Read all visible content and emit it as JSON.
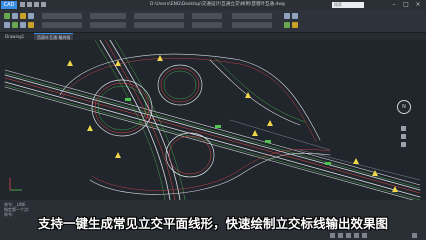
{
  "app": {
    "logo": "CAD",
    "title": "D:\\Users\\ENG\\Desktop\\交通设计\\互通立交\\样例\\苜蓿叶互通.dwg",
    "search_placeholder": "搜索"
  },
  "tabs": [
    {
      "label": "Drawing1"
    },
    {
      "label": "苜蓿叶互通-最终版"
    }
  ],
  "command_lines": [
    "命令: _LINE",
    "指定第一个点:",
    "命令:"
  ],
  "caption": "支持一键生成常见立交平面线形，快速绘制立交标线输出效果图",
  "colors": {
    "background": "#21252c",
    "road_edge": "#d8dbe0",
    "red_line": "#e04a4a",
    "green_line": "#4fc24f",
    "arrow": "#f0d84a"
  },
  "icons": [
    "minimize-icon",
    "maximize-icon",
    "close-icon",
    "compass-icon",
    "ucs-icon"
  ]
}
